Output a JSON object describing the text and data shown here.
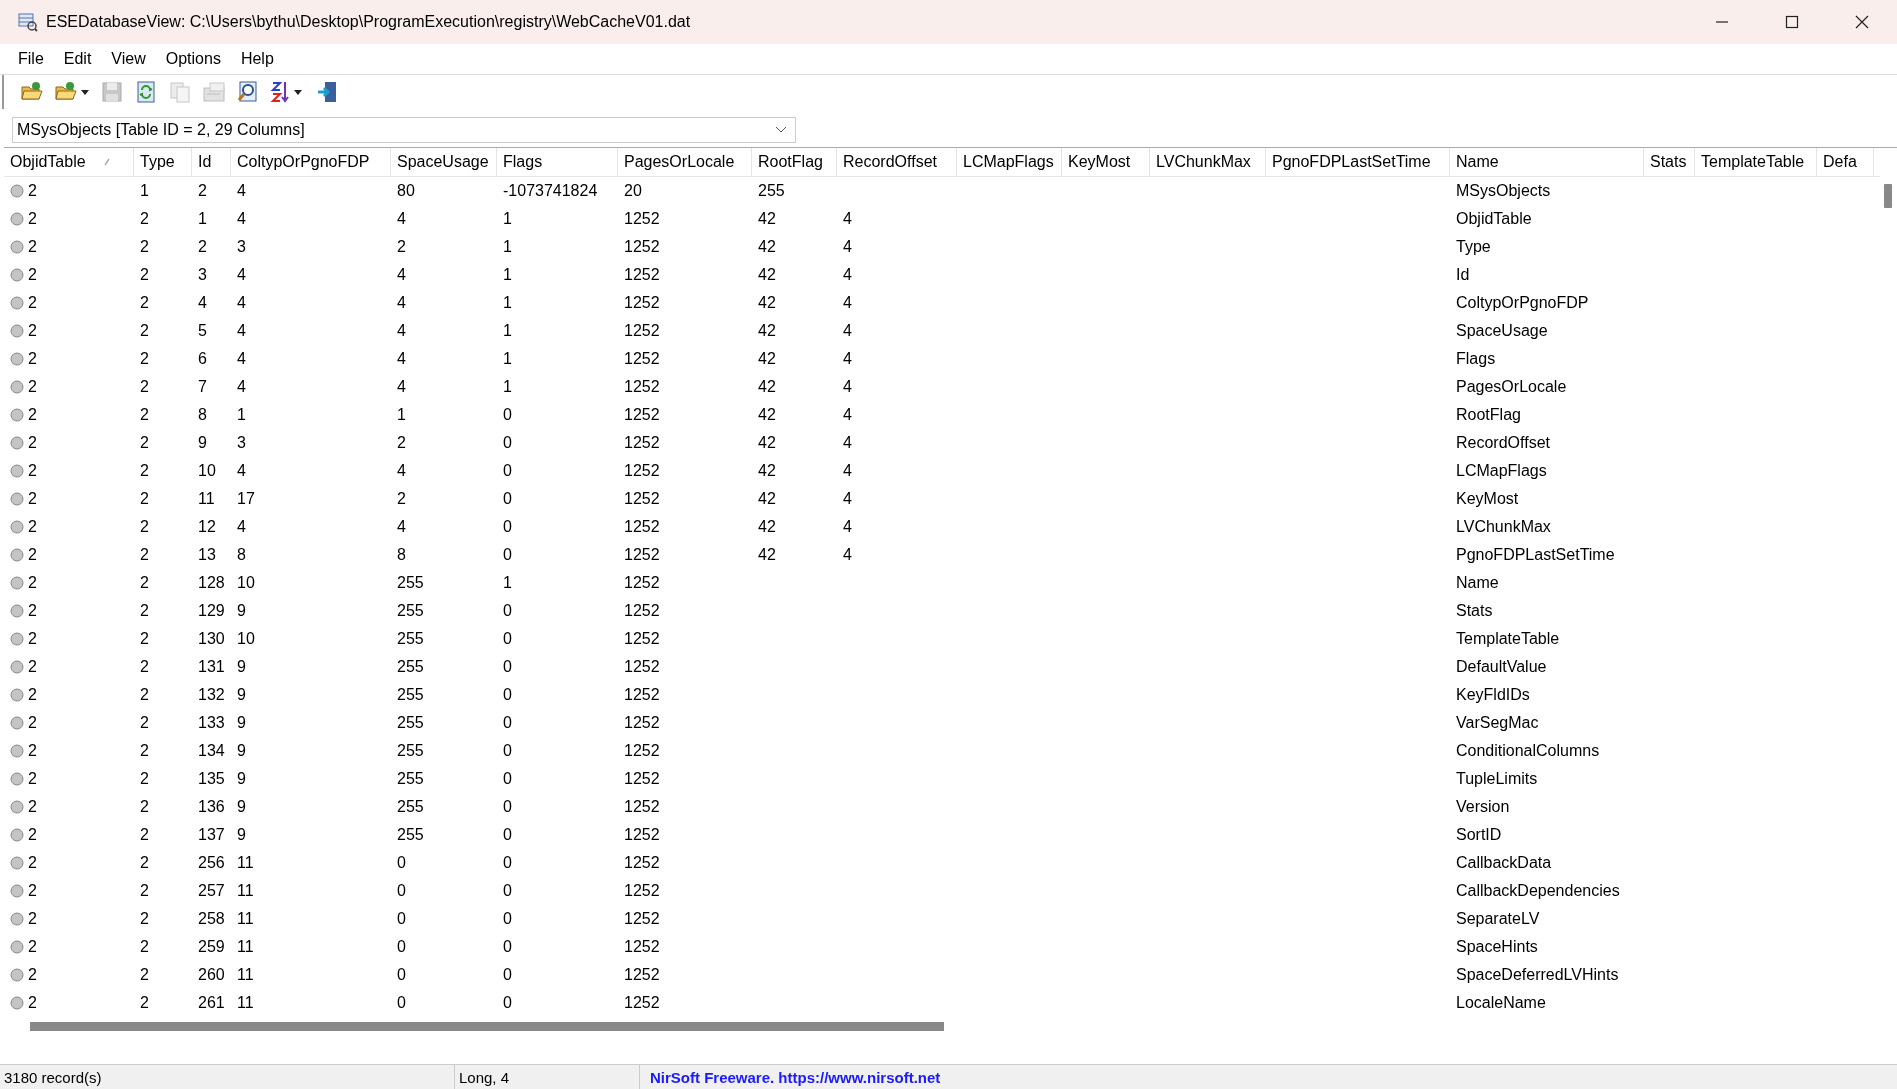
{
  "window": {
    "title": "ESEDatabaseView:   C:\\Users\\bythu\\Desktop\\ProgramExecution\\registry\\WebCacheV01.dat"
  },
  "menu": [
    "File",
    "Edit",
    "View",
    "Options",
    "Help"
  ],
  "toolbar": [
    {
      "kind": "open",
      "disabled": false
    },
    {
      "kind": "open-menu",
      "disabled": false
    },
    {
      "kind": "save",
      "disabled": true
    },
    {
      "kind": "refresh",
      "disabled": false
    },
    {
      "kind": "copy",
      "disabled": true
    },
    {
      "kind": "properties",
      "disabled": true
    },
    {
      "kind": "find",
      "disabled": false
    },
    {
      "kind": "sort",
      "disabled": false
    },
    {
      "kind": "exit",
      "disabled": false
    }
  ],
  "table_selector": {
    "value": "MSysObjects   [Table ID = 2, 29 Columns]"
  },
  "table": {
    "columns": [
      "ObjidTable",
      "Type",
      "Id",
      "ColtypOrPgnoFDP",
      "SpaceUsage",
      "Flags",
      "PagesOrLocale",
      "RootFlag",
      "RecordOffset",
      "LCMapFlags",
      "KeyMost",
      "LVChunkMax",
      "PgnoFDPLastSetTime",
      "Name",
      "Stats",
      "TemplateTable",
      "Defa"
    ],
    "rows": [
      [
        "2",
        "1",
        "2",
        "4",
        "80",
        "-1073741824",
        "20",
        "255",
        null,
        null,
        null,
        null,
        null,
        "MSysObjects"
      ],
      [
        "2",
        "2",
        "1",
        "4",
        "4",
        "1",
        "1252",
        "42",
        "4",
        null,
        null,
        null,
        null,
        "ObjidTable"
      ],
      [
        "2",
        "2",
        "2",
        "3",
        "2",
        "1",
        "1252",
        "42",
        "4",
        null,
        null,
        null,
        null,
        "Type"
      ],
      [
        "2",
        "2",
        "3",
        "4",
        "4",
        "1",
        "1252",
        "42",
        "4",
        null,
        null,
        null,
        null,
        "Id"
      ],
      [
        "2",
        "2",
        "4",
        "4",
        "4",
        "1",
        "1252",
        "42",
        "4",
        null,
        null,
        null,
        null,
        "ColtypOrPgnoFDP"
      ],
      [
        "2",
        "2",
        "5",
        "4",
        "4",
        "1",
        "1252",
        "42",
        "4",
        null,
        null,
        null,
        null,
        "SpaceUsage"
      ],
      [
        "2",
        "2",
        "6",
        "4",
        "4",
        "1",
        "1252",
        "42",
        "4",
        null,
        null,
        null,
        null,
        "Flags"
      ],
      [
        "2",
        "2",
        "7",
        "4",
        "4",
        "1",
        "1252",
        "42",
        "4",
        null,
        null,
        null,
        null,
        "PagesOrLocale"
      ],
      [
        "2",
        "2",
        "8",
        "1",
        "1",
        "0",
        "1252",
        "42",
        "4",
        null,
        null,
        null,
        null,
        "RootFlag"
      ],
      [
        "2",
        "2",
        "9",
        "3",
        "2",
        "0",
        "1252",
        "42",
        "4",
        null,
        null,
        null,
        null,
        "RecordOffset"
      ],
      [
        "2",
        "2",
        "10",
        "4",
        "4",
        "0",
        "1252",
        "42",
        "4",
        null,
        null,
        null,
        null,
        "LCMapFlags"
      ],
      [
        "2",
        "2",
        "11",
        "17",
        "2",
        "0",
        "1252",
        "42",
        "4",
        null,
        null,
        null,
        null,
        "KeyMost"
      ],
      [
        "2",
        "2",
        "12",
        "4",
        "4",
        "0",
        "1252",
        "42",
        "4",
        null,
        null,
        null,
        null,
        "LVChunkMax"
      ],
      [
        "2",
        "2",
        "13",
        "8",
        "8",
        "0",
        "1252",
        "42",
        "4",
        null,
        null,
        null,
        null,
        "PgnoFDPLastSetTime"
      ],
      [
        "2",
        "2",
        "128",
        "10",
        "255",
        "1",
        "1252",
        null,
        null,
        null,
        null,
        null,
        null,
        "Name"
      ],
      [
        "2",
        "2",
        "129",
        "9",
        "255",
        "0",
        "1252",
        null,
        null,
        null,
        null,
        null,
        null,
        "Stats"
      ],
      [
        "2",
        "2",
        "130",
        "10",
        "255",
        "0",
        "1252",
        null,
        null,
        null,
        null,
        null,
        null,
        "TemplateTable"
      ],
      [
        "2",
        "2",
        "131",
        "9",
        "255",
        "0",
        "1252",
        null,
        null,
        null,
        null,
        null,
        null,
        "DefaultValue"
      ],
      [
        "2",
        "2",
        "132",
        "9",
        "255",
        "0",
        "1252",
        null,
        null,
        null,
        null,
        null,
        null,
        "KeyFldIDs"
      ],
      [
        "2",
        "2",
        "133",
        "9",
        "255",
        "0",
        "1252",
        null,
        null,
        null,
        null,
        null,
        null,
        "VarSegMac"
      ],
      [
        "2",
        "2",
        "134",
        "9",
        "255",
        "0",
        "1252",
        null,
        null,
        null,
        null,
        null,
        null,
        "ConditionalColumns"
      ],
      [
        "2",
        "2",
        "135",
        "9",
        "255",
        "0",
        "1252",
        null,
        null,
        null,
        null,
        null,
        null,
        "TupleLimits"
      ],
      [
        "2",
        "2",
        "136",
        "9",
        "255",
        "0",
        "1252",
        null,
        null,
        null,
        null,
        null,
        null,
        "Version"
      ],
      [
        "2",
        "2",
        "137",
        "9",
        "255",
        "0",
        "1252",
        null,
        null,
        null,
        null,
        null,
        null,
        "SortID"
      ],
      [
        "2",
        "2",
        "256",
        "11",
        "0",
        "0",
        "1252",
        null,
        null,
        null,
        null,
        null,
        null,
        "CallbackData"
      ],
      [
        "2",
        "2",
        "257",
        "11",
        "0",
        "0",
        "1252",
        null,
        null,
        null,
        null,
        null,
        null,
        "CallbackDependencies"
      ],
      [
        "2",
        "2",
        "258",
        "11",
        "0",
        "0",
        "1252",
        null,
        null,
        null,
        null,
        null,
        null,
        "SeparateLV"
      ],
      [
        "2",
        "2",
        "259",
        "11",
        "0",
        "0",
        "1252",
        null,
        null,
        null,
        null,
        null,
        null,
        "SpaceHints"
      ],
      [
        "2",
        "2",
        "260",
        "11",
        "0",
        "0",
        "1252",
        null,
        null,
        null,
        null,
        null,
        null,
        "SpaceDeferredLVHints"
      ],
      [
        "2",
        "2",
        "261",
        "11",
        "0",
        "0",
        "1252",
        null,
        null,
        null,
        null,
        null,
        null,
        "LocaleName"
      ]
    ]
  },
  "status_bar": {
    "records": "3180 record(s)",
    "value": "Long, 4",
    "link": "NirSoft Freeware. https://www.nirsoft.net"
  }
}
